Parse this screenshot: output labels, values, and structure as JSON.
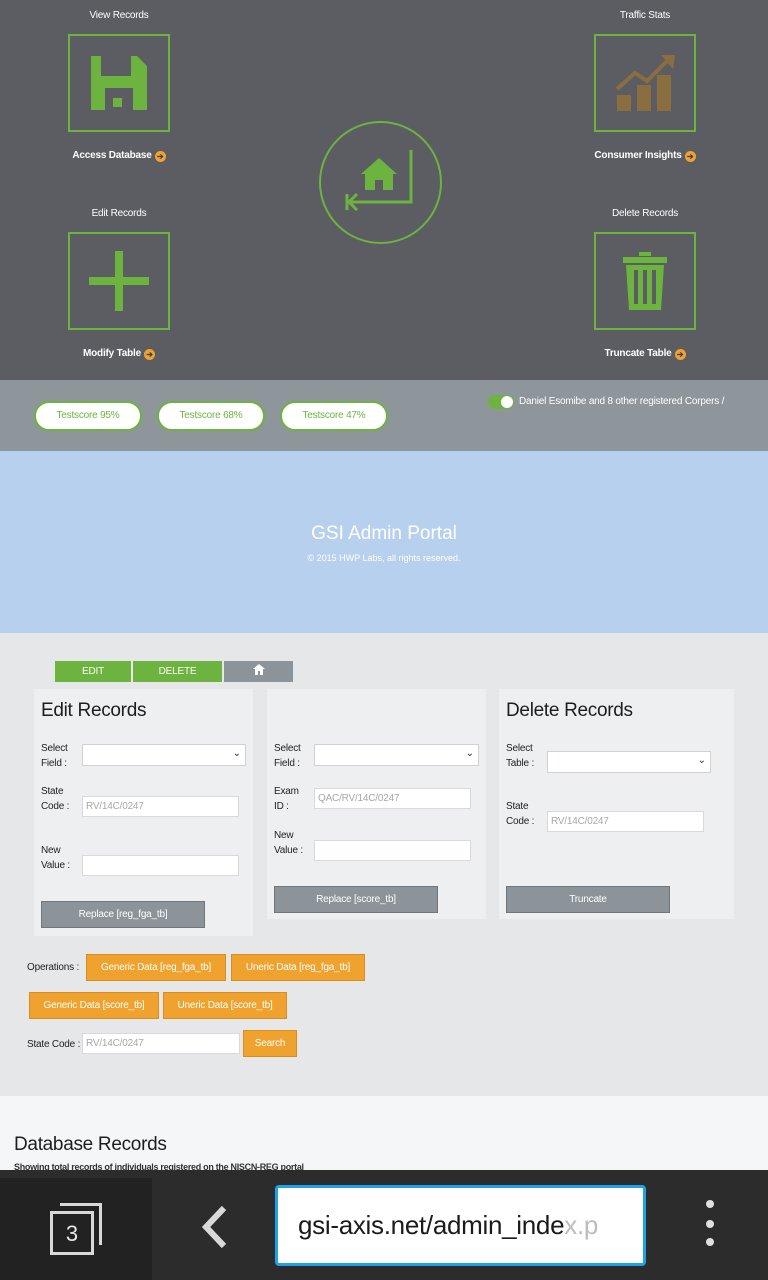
{
  "dashboard": {
    "view_records": {
      "caption": "View Records",
      "link": "Access Database",
      "icon": "floppy-disk-icon"
    },
    "traffic_stats": {
      "caption": "Traffic Stats",
      "link": "Consumer Insights",
      "icon": "growth-chart-icon"
    },
    "edit_records": {
      "caption": "Edit Records",
      "link": "Modify Table",
      "icon": "plus-icon"
    },
    "delete_records": {
      "caption": "Delete Records",
      "link": "Truncate Table",
      "icon": "trash-icon"
    },
    "home_icon": "home-return-icon",
    "arrow_glyph": "➔",
    "colors": {
      "background": "#5c5d63",
      "accent": "#6db33f",
      "link_dot": "#f0a22e"
    }
  },
  "scores": {
    "pills": [
      "Testscore 95%",
      "Testscore 68%",
      "Testscore 47%"
    ],
    "toggle_on": true,
    "registered_text": "Daniel Esomibe and 8 other registered Corpers /"
  },
  "banner": {
    "title": "GSI Admin Portal",
    "copyright": "© 2015 HWP Labs, all rights reserved.",
    "color": "#b7d0ee"
  },
  "admin": {
    "tabs": {
      "edit": "EDIT",
      "delete": "DELETE",
      "home_icon": "home-icon"
    },
    "edit_panel": {
      "title": "Edit Records",
      "select_field_label": "Select Field :",
      "state_code_label": "State Code :",
      "state_code_placeholder": "RV/14C/0247",
      "new_value_label": "New Value :",
      "button": "Replace [reg_fga_tb]"
    },
    "score_panel": {
      "select_field_label": "Select Field :",
      "exam_id_label": "Exam ID :",
      "exam_id_placeholder": "QAC/RV/14C/0247",
      "new_value_label": "New Value :",
      "button": "Replace [score_tb]"
    },
    "delete_panel": {
      "title": "Delete Records",
      "select_table_label": "Select Table :",
      "state_code_label": "State Code :",
      "state_code_placeholder": "RV/14C/0247",
      "button": "Truncate"
    },
    "operations": {
      "label": "Operations :",
      "buttons": [
        "Generic Data [reg_fga_tb]",
        "Uneric Data [reg_fga_tb]",
        "Generic Data [score_tb]",
        "Uneric Data [score_tb]"
      ]
    },
    "search": {
      "label": "State Code :",
      "placeholder": "RV/14C/0247",
      "button": "Search"
    },
    "colors": {
      "green": "#6db33f",
      "grey": "#8c9499",
      "orange": "#f0a22e"
    }
  },
  "records": {
    "title": "Database Records",
    "subtitle": "Showing total records of individuals registered on the NISCN-REG portal"
  },
  "browser": {
    "tab_count": "3",
    "url_main": "gsi-axis.net/admin_inde",
    "url_fade": "x.p",
    "accent": "#1fa3e8"
  }
}
